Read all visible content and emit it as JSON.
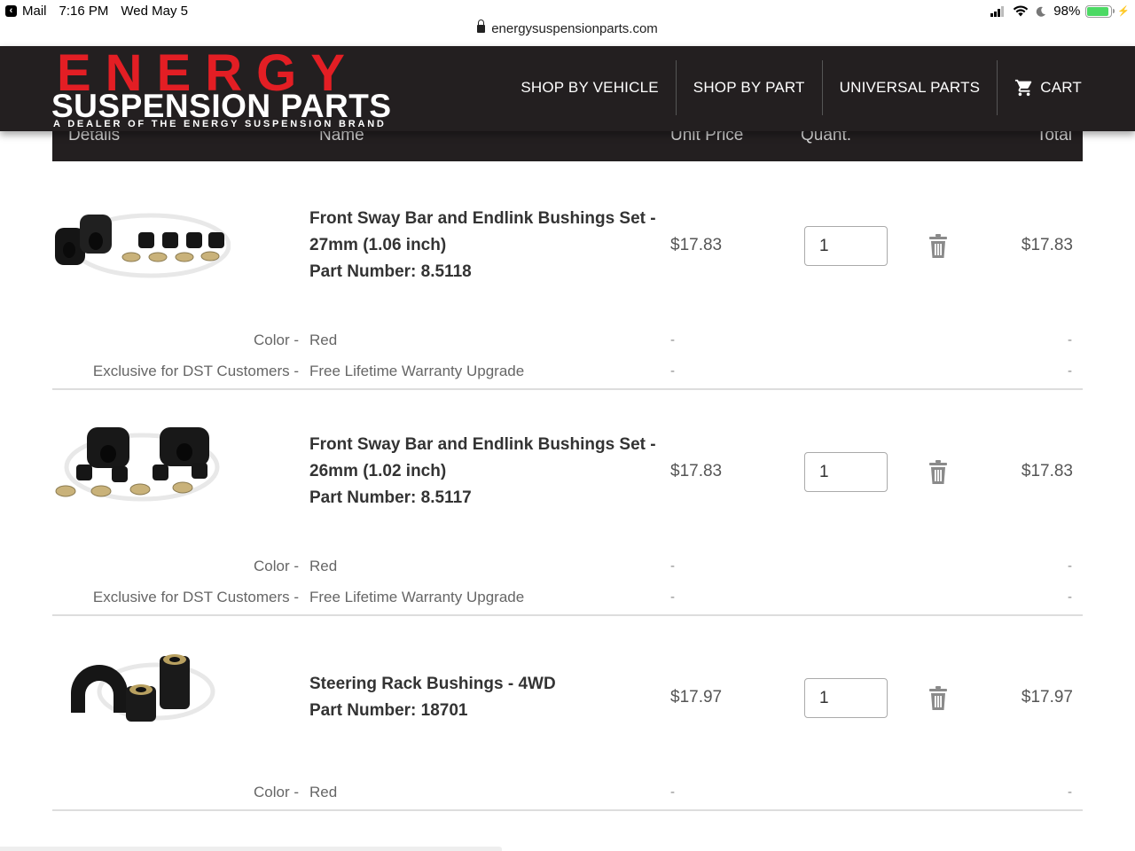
{
  "status_bar": {
    "back_app": "Mail",
    "time": "7:16 PM",
    "date": "Wed May 5",
    "url": "energysuspensionparts.com",
    "battery": "98%"
  },
  "header": {
    "logo_top": "ENERGY",
    "logo_middle": "SUSPENSION PARTS",
    "logo_tagline": "A DEALER OF THE ENERGY SUSPENSION BRAND",
    "nav": [
      "SHOP BY VEHICLE",
      "SHOP BY PART",
      "UNIVERSAL PARTS",
      "CART"
    ]
  },
  "table": {
    "columns": {
      "details": "Details",
      "name": "Name",
      "unit_price": "Unit Price",
      "quantity": "Quant.",
      "total": "Total"
    },
    "items": [
      {
        "name_line1": "Front Sway Bar and Endlink Bushings Set -",
        "name_line2": "27mm (1.06 inch)",
        "part_number": "Part Number: 8.5118",
        "unit_price": "$17.83",
        "quantity": "1",
        "total": "$17.83",
        "options": [
          {
            "label": "Color -",
            "value": "Red",
            "price": "-",
            "total": "-"
          },
          {
            "label": "Exclusive for DST Customers -",
            "value": "Free Lifetime Warranty Upgrade",
            "price": "-",
            "total": "-"
          }
        ]
      },
      {
        "name_line1": "Front Sway Bar and Endlink Bushings Set -",
        "name_line2": "26mm (1.02 inch)",
        "part_number": "Part Number: 8.5117",
        "unit_price": "$17.83",
        "quantity": "1",
        "total": "$17.83",
        "options": [
          {
            "label": "Color -",
            "value": "Red",
            "price": "-",
            "total": "-"
          },
          {
            "label": "Exclusive for DST Customers -",
            "value": "Free Lifetime Warranty Upgrade",
            "price": "-",
            "total": "-"
          }
        ]
      },
      {
        "name_line1": "Steering Rack Bushings - 4WD",
        "part_number": "Part Number: 18701",
        "unit_price": "$17.97",
        "quantity": "1",
        "total": "$17.97",
        "options": [
          {
            "label": "Color -",
            "value": "Red",
            "price": "-",
            "total": "-"
          }
        ]
      }
    ]
  },
  "colors": {
    "header_bg": "#231f20",
    "logo_red": "#e31e24",
    "battery_green": "#4cd964"
  },
  "icons": [
    "lock-icon",
    "wifi-icon",
    "moon-icon",
    "battery-icon",
    "cart-icon",
    "trash-icon"
  ]
}
